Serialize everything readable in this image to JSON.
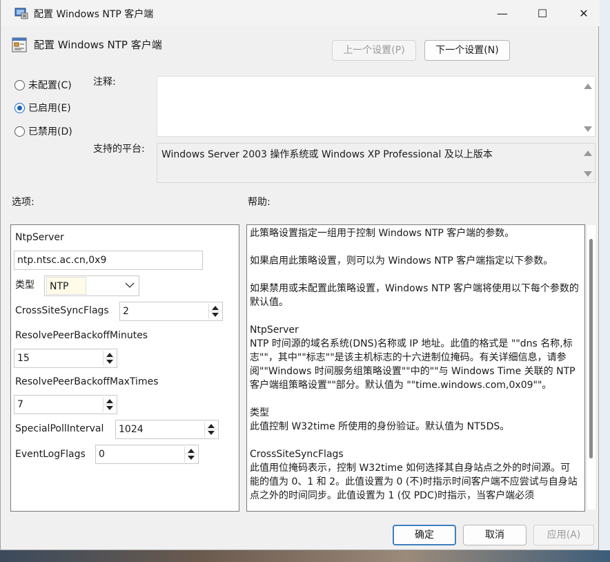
{
  "window": {
    "title": "配置 Windows NTP 客户端",
    "minimize": "—",
    "maximize": "☐",
    "close": "✕"
  },
  "header": {
    "title": "配置 Windows  NTP 客户端",
    "prev_button": "上一个设置(P)",
    "next_button": "下一个设置(N)"
  },
  "state": {
    "options": [
      {
        "label": "未配置(C)",
        "selected": false
      },
      {
        "label": "已启用(E)",
        "selected": true
      },
      {
        "label": "已禁用(D)",
        "selected": false
      }
    ]
  },
  "comment": {
    "label": "注释:",
    "value": ""
  },
  "platform": {
    "label": "支持的平台:",
    "value": "Windows Server 2003 操作系统或 Windows XP Professional 及以上版本"
  },
  "options_label": "选项:",
  "help_label": "帮助:",
  "options": {
    "ntpserver_label": "NtpServer",
    "ntpserver_value": "ntp.ntsc.ac.cn,0x9",
    "type_label": "类型",
    "type_value": "NTP",
    "crosssite_label": "CrossSiteSyncFlags",
    "crosssite_value": "2",
    "backoff_min_label": "ResolvePeerBackoffMinutes",
    "backoff_min_value": "15",
    "backoff_max_label": "ResolvePeerBackoffMaxTimes",
    "backoff_max_value": "7",
    "specialpoll_label": "SpecialPollInterval",
    "specialpoll_value": "1024",
    "eventlog_label": "EventLogFlags",
    "eventlog_value": "0"
  },
  "help": {
    "paragraphs": [
      "此策略设置指定一组用于控制 Windows NTP 客户端的参数。",
      "如果启用此策略设置，则可以为 Windows NTP 客户端指定以下参数。",
      "如果禁用或未配置此策略设置，Windows NTP 客户端将使用以下每个参数的默认值。",
      "NtpServer\nNTP 时间源的域名系统(DNS)名称或 IP 地址。此值的格式是 \"\"dns 名称,标志\"\"，其中\"\"标志\"\"是该主机标志的十六进制位掩码。有关详细信息，请参阅\"\"Windows 时间服务组策略设置\"\"中的\"\"与 Windows Time 关联的 NTP 客户端组策略设置\"\"部分。默认值为 \"\"time.windows.com,0x09\"\"。",
      "类型\n此值控制 W32time 所使用的身份验证。默认值为 NT5DS。",
      "CrossSiteSyncFlags\n此值用位掩码表示，控制 W32time 如何选择其自身站点之外的时间源。可能的值为 0、1 和 2。此值设置为 0 (不)时指示时间客户端不应尝试与自身站点之外的时间同步。此值设置为 1 (仅 PDC)时指示，当客户端必须"
    ]
  },
  "footer": {
    "ok": "确定",
    "cancel": "取消",
    "apply": "应用(A)"
  }
}
